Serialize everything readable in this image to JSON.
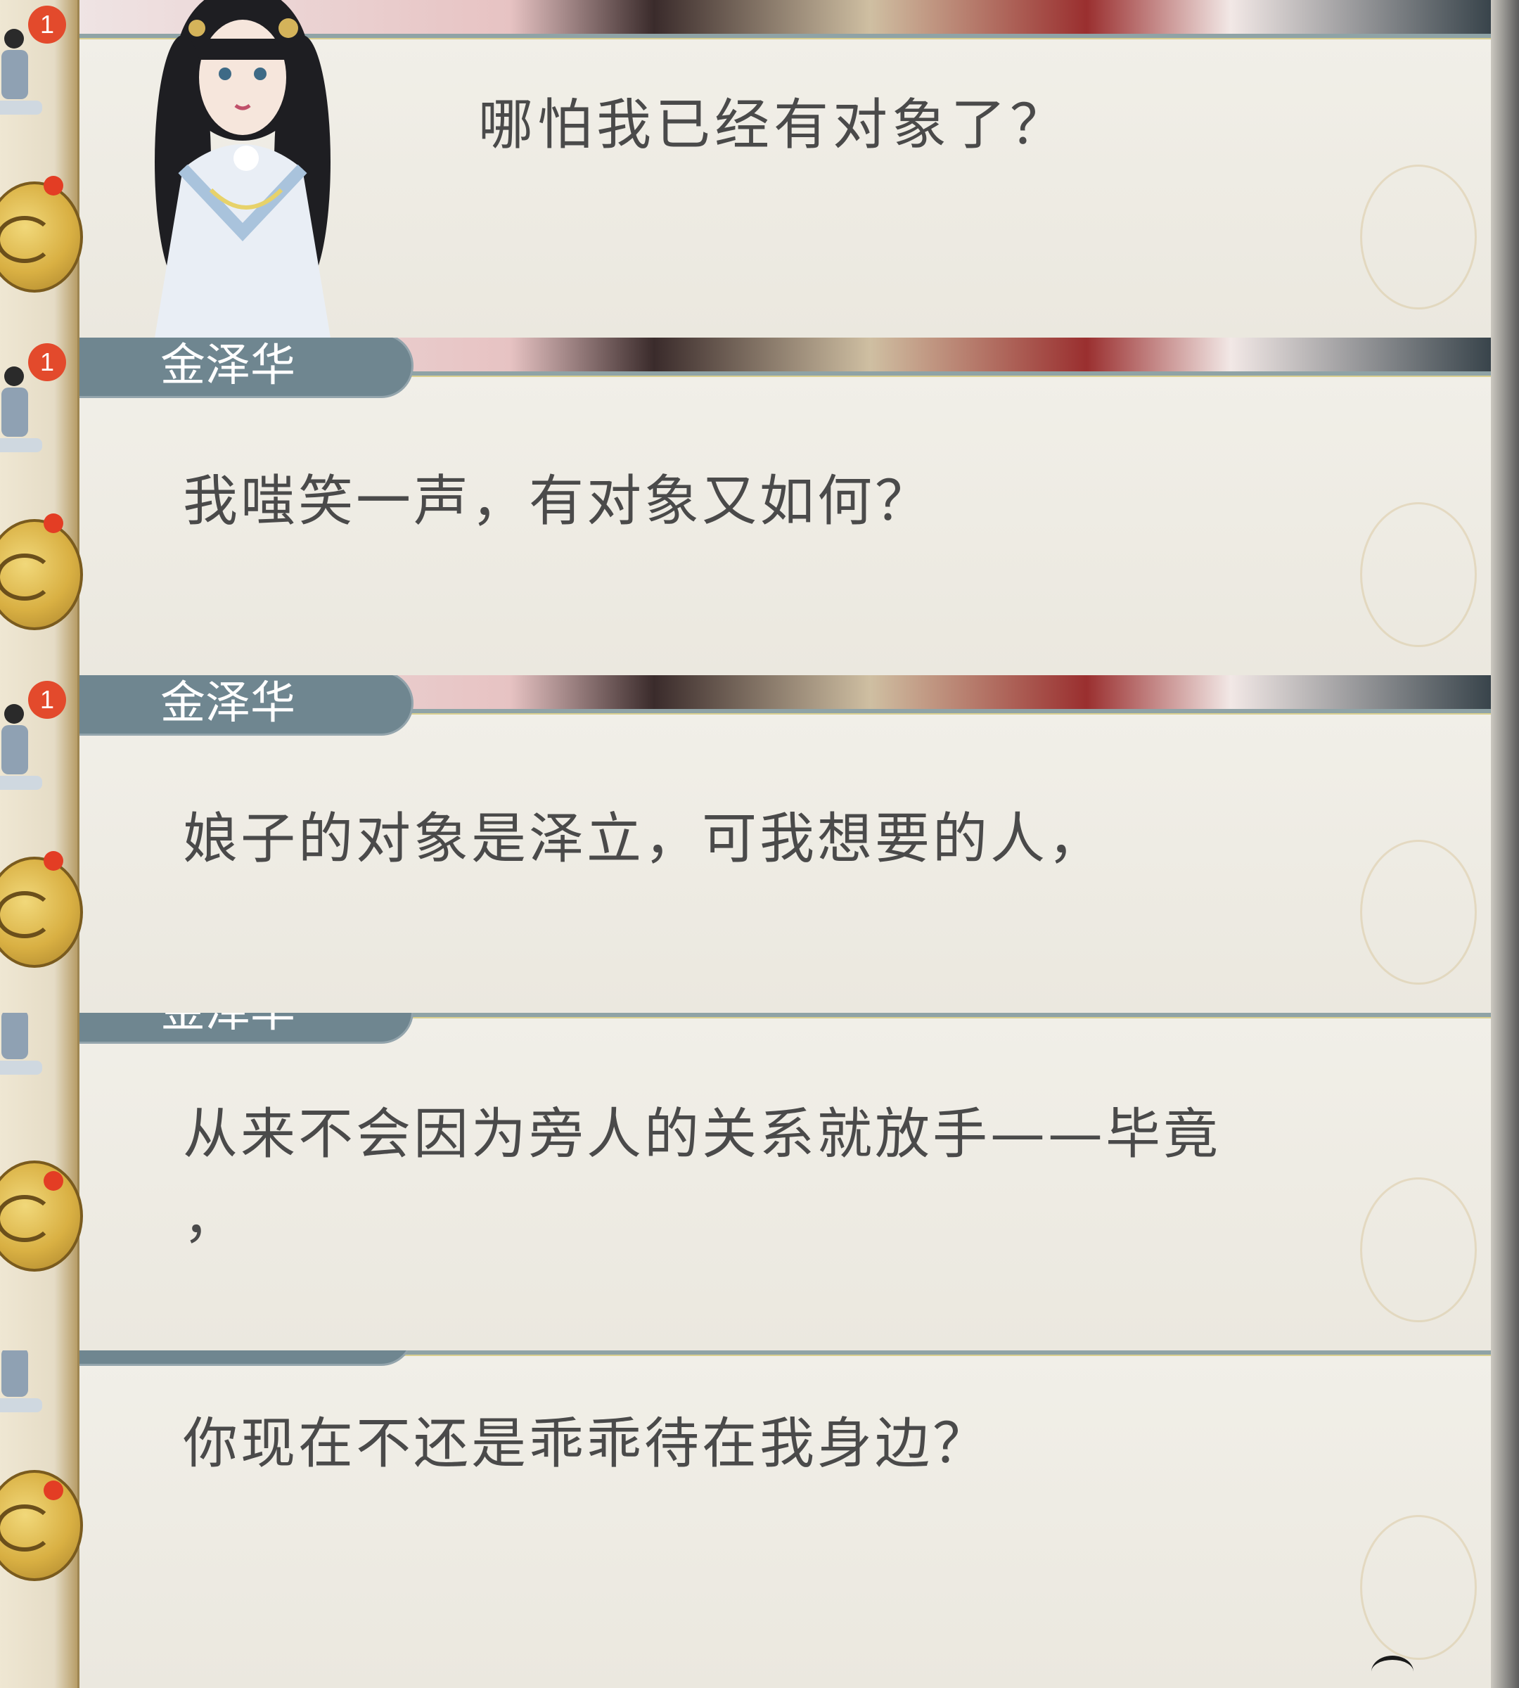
{
  "panels": [
    {
      "speaker": "",
      "badge": "1",
      "lines": [
        "哪怕我已经有对象了？"
      ],
      "portrait": "female-character-portrait"
    },
    {
      "speaker": "金泽华",
      "badge": "1",
      "lines": [
        "我嗤笑一声，有对象又如何？"
      ]
    },
    {
      "speaker": "金泽华",
      "badge": "1",
      "lines": [
        "娘子的对象是泽立，可我想要的人，"
      ]
    },
    {
      "speaker": "金泽华",
      "badge": "",
      "lines": [
        "从来不会因为旁人的关系就放手——毕竟",
        "，"
      ]
    },
    {
      "speaker": "",
      "badge": "",
      "lines": [
        "你现在不还是乖乖待在我身边？"
      ]
    }
  ],
  "colors": {
    "nameplate": "#6f8690",
    "paper": "#ebe8df",
    "text": "#4a4a4a",
    "badge": "#e34a2c",
    "coin": "#d9b043"
  }
}
